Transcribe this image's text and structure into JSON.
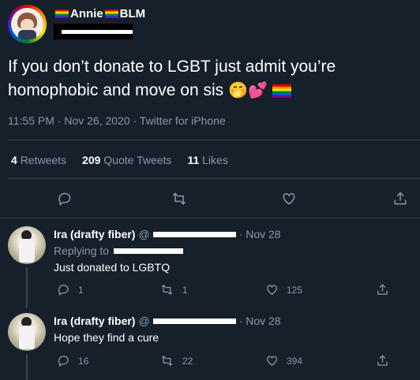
{
  "tweet": {
    "name_first": "Annie",
    "name_second": "BLM",
    "text_line1": "If you don’t donate to LGBT just admit you’re",
    "text_line2": "homophobic and move on sis",
    "emojis": "🤭💕",
    "meta": "11:55 PM · Nov 26, 2020 · Twitter for iPhone",
    "stats": {
      "retweets_count": "4",
      "retweets_label": "Retweets",
      "quotes_count": "209",
      "quotes_label": "Quote Tweets",
      "likes_count": "11",
      "likes_label": "Likes"
    },
    "action_icons": [
      "reply-icon",
      "retweet-icon",
      "like-icon",
      "share-icon"
    ]
  },
  "replies": [
    {
      "name": "Ira (drafty fiber)",
      "handle_prefix": "@",
      "date": "· Nov 28",
      "replying_label": "Replying to",
      "text": "Just donated to LGBTQ",
      "reply_count": "1",
      "retweet_count": "1",
      "like_count": "125"
    },
    {
      "name": "Ira (drafty fiber)",
      "handle_prefix": "@",
      "date": "· Nov 28",
      "text": "Hope they find a cure",
      "reply_count": "16",
      "retweet_count": "22",
      "like_count": "394"
    }
  ],
  "colors": {
    "background": "#15202b",
    "muted": "#8899a6",
    "divider": "#38444d",
    "text": "#ffffff"
  }
}
